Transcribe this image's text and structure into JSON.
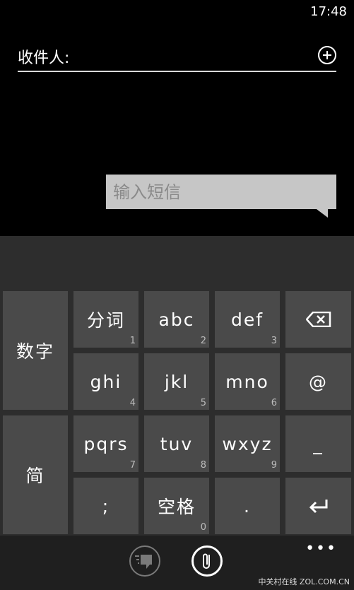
{
  "status": {
    "time": "17:48"
  },
  "compose": {
    "recipient_label": "收件人:",
    "message_placeholder": "输入短信"
  },
  "keyboard": {
    "left_keys": [
      "数字",
      "简"
    ],
    "rows": [
      [
        {
          "label": "分词",
          "num": "1"
        },
        {
          "label": "abc",
          "num": "2"
        },
        {
          "label": "def",
          "num": "3"
        }
      ],
      [
        {
          "label": "ghi",
          "num": "4"
        },
        {
          "label": "jkl",
          "num": "5"
        },
        {
          "label": "mno",
          "num": "6"
        }
      ],
      [
        {
          "label": "pqrs",
          "num": "7"
        },
        {
          "label": "tuv",
          "num": "8"
        },
        {
          "label": "wxyz",
          "num": "9"
        }
      ],
      [
        {
          "label": ";",
          "num": ""
        },
        {
          "label": "空格",
          "num": "0"
        },
        {
          "label": ".",
          "num": ""
        }
      ]
    ],
    "right_keys": [
      "⌫",
      "@",
      "_",
      "↵"
    ]
  },
  "appbar": {
    "more": "•••"
  },
  "watermark": {
    "text": "中关村在线 ZOL.COM.CN"
  }
}
